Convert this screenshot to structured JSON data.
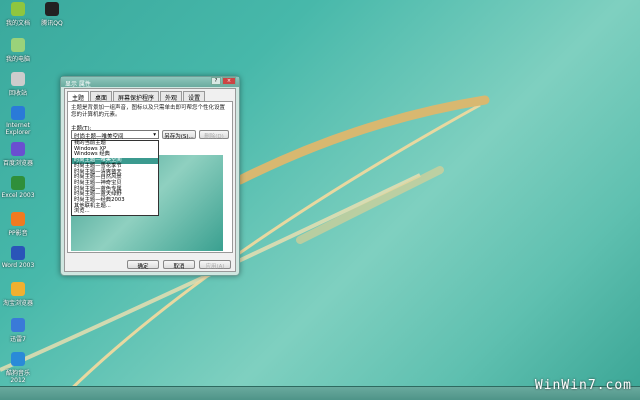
{
  "desktop_icons": [
    {
      "label": "我的文档",
      "color": "#8fc63f"
    },
    {
      "label": "腾讯QQ",
      "color": "#222"
    },
    {
      "label": "我的电脑",
      "color": "#9ad27a"
    },
    {
      "label": "回收站",
      "color": "#ccc"
    },
    {
      "label": "Internet Explorer",
      "color": "#2a7ad8"
    },
    {
      "label": "百度浏览器",
      "color": "#6a4fd0"
    },
    {
      "label": "Excel 2003",
      "color": "#2f8f3a"
    },
    {
      "label": "PP影音",
      "color": "#f07a20"
    },
    {
      "label": "Word 2003",
      "color": "#2a55b8"
    },
    {
      "label": "淘宝浏览器",
      "color": "#f0b030"
    },
    {
      "label": "迅雷7",
      "color": "#3a7ad8"
    },
    {
      "label": "酷狗音乐2012",
      "color": "#2a8ad8"
    }
  ],
  "dialog": {
    "title": "显示 属性",
    "tabs": [
      "主题",
      "桌面",
      "屏幕保护程序",
      "外观",
      "设置"
    ],
    "description": "主题是背景加一组声音，图标以及只需单击即可帮您个性化设置您的计算机的元素。",
    "theme_label": "主题(T):",
    "theme_value": "时尚主题—唯美空间",
    "save_as": "另存为(S)...",
    "delete": "删除(D)",
    "dropdown_items": [
      "我的当前主题",
      "Windows XP",
      "Windows 经典",
      "时尚主题—唯美空间",
      "时尚主题—雪花季节",
      "时尚主题—清爽蓝天",
      "时尚主题—自然风景",
      "时尚主题—神奇宝贝",
      "时尚主题—蓝色专属",
      "时尚主题—蓝天绿野",
      "时尚主题—经典2003",
      "其他联机主题...",
      "浏览..."
    ],
    "selected_index": 3,
    "ok": "确定",
    "cancel": "取消",
    "apply": "应用(A)"
  },
  "watermark": "WinWin7.com"
}
